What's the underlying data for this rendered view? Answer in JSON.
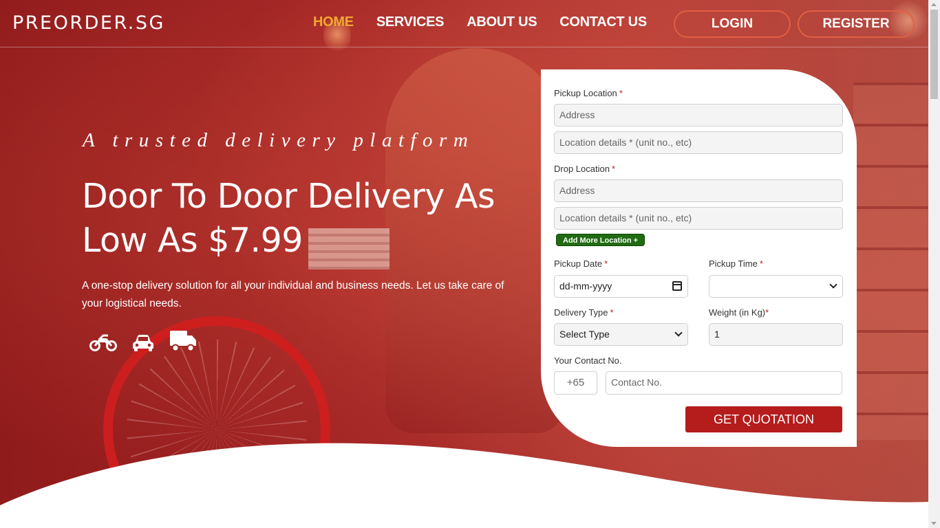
{
  "brand": {
    "logo": "PREORDER.SG"
  },
  "nav": {
    "items": [
      {
        "label": "HOME",
        "active": true
      },
      {
        "label": "SERVICES"
      },
      {
        "label": "ABOUT US"
      },
      {
        "label": "CONTACT US"
      }
    ],
    "login": "LOGIN",
    "register": "REGISTER"
  },
  "hero": {
    "tagline": "A trusted delivery platform",
    "headline": "Door To Door Delivery As Low As $7.99",
    "description": "A one-stop delivery solution for all your individual and business needs. Let us take care of your logistical needs.",
    "vehicle_icons": [
      "motorcycle-icon",
      "car-icon",
      "truck-icon"
    ]
  },
  "form": {
    "pickup_location_label": "Pickup Location",
    "pickup_address_placeholder": "Address",
    "pickup_details_placeholder": "Location details * (unit no., etc)",
    "drop_location_label": "Drop Location",
    "drop_address_placeholder": "Address",
    "drop_details_placeholder": "Location details * (unit no., etc)",
    "add_more_label": "Add More Location +",
    "pickup_date_label": "Pickup Date",
    "pickup_date_value": "dd-mm-yyyy",
    "pickup_time_label": "Pickup Time",
    "pickup_time_value": "",
    "delivery_type_label": "Delivery Type",
    "delivery_type_value": "Select Type",
    "weight_label": "Weight (in Kg)",
    "weight_value": "1",
    "contact_label": "Your Contact No.",
    "country_code": "+65",
    "contact_placeholder": "Contact No.",
    "submit_label": "GET QUOTATION",
    "required_mark": "*"
  },
  "colors": {
    "accent": "#f0a830",
    "primary_red": "#b51c1c",
    "add_more_green": "#1f6b12"
  }
}
